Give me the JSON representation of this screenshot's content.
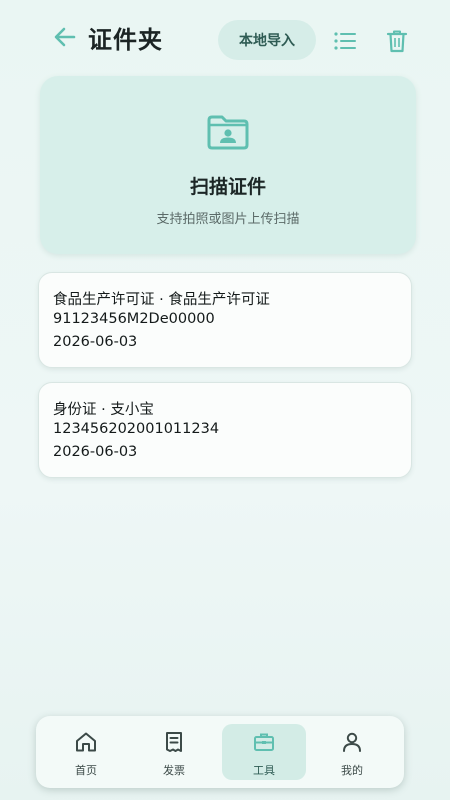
{
  "colors": {
    "accent": "#5fbfb0",
    "card_bg": "#d7efea",
    "page_bg": "#eaf6f3",
    "active_tab_bg": "#d3ece6"
  },
  "header": {
    "back_icon": "arrow-left-icon",
    "title": "证件夹",
    "import_label": "本地导入",
    "list_icon": "list-icon",
    "trash_icon": "trash-icon"
  },
  "scan": {
    "icon": "folder-id-icon",
    "title": "扫描证件",
    "subtitle": "支持拍照或图片上传扫描"
  },
  "documents": [
    {
      "title": "食品生产许可证 · 食品生产许可证",
      "number": "91123456M2De00000",
      "date": "2026-06-03"
    },
    {
      "title": "身份证 · 支小宝",
      "number": "123456202001011234",
      "date": "2026-06-03"
    }
  ],
  "nav": {
    "items": [
      {
        "label": "首页",
        "icon": "home-icon",
        "active": false
      },
      {
        "label": "发票",
        "icon": "receipt-icon",
        "active": false
      },
      {
        "label": "工具",
        "icon": "toolbox-icon",
        "active": true
      },
      {
        "label": "我的",
        "icon": "user-icon",
        "active": false
      }
    ]
  }
}
